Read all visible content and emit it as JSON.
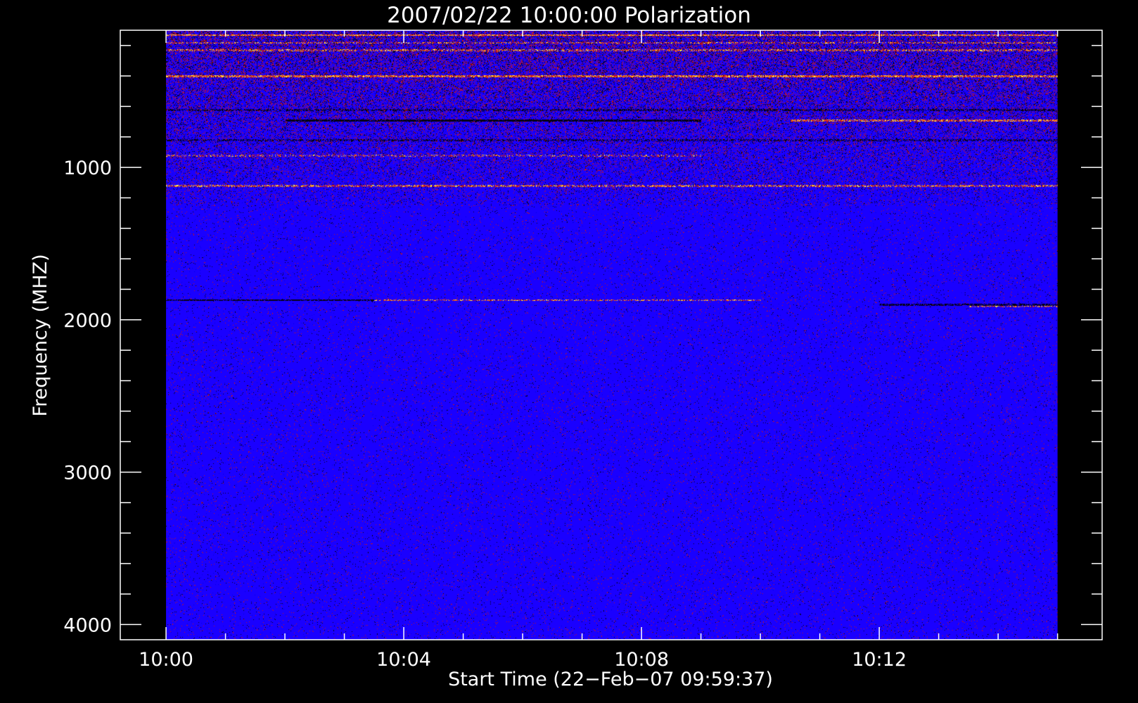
{
  "chart_data": {
    "type": "heatmap",
    "title": "2007/02/22 10:00:00 Polarization",
    "xlabel": "Start Time (22−Feb−07 09:59:37)",
    "ylabel": "Frequency (MHZ)",
    "x_ticks": [
      "10:00",
      "10:04",
      "10:08",
      "10:12"
    ],
    "x_tick_minutes": [
      0,
      4,
      8,
      12
    ],
    "x_range_minutes": [
      -0.77,
      15.75
    ],
    "x_data_range_minutes": [
      0,
      15
    ],
    "y_ticks": [
      1000,
      2000,
      3000,
      4000
    ],
    "y_range_mhz": [
      100,
      4100
    ],
    "y_data_range_mhz": [
      100,
      4100
    ],
    "y_inverted": true,
    "colors": {
      "background": "#000000",
      "axes": "#ffffff",
      "base_spectrum": "#1a00ff",
      "deep_blue": "#0000e6",
      "dark_line": "#050014",
      "red": "#c8141e",
      "orange": "#ff8c1e",
      "yellow": "#ffff50"
    },
    "features": [
      {
        "freq_mhz": 130,
        "kind": "bright",
        "start_min": 0,
        "end_min": 15,
        "intensity": 0.9
      },
      {
        "freq_mhz": 180,
        "kind": "bright",
        "start_min": 0,
        "end_min": 15,
        "intensity": 0.5
      },
      {
        "freq_mhz": 230,
        "kind": "bright",
        "start_min": 0,
        "end_min": 15,
        "intensity": 0.55
      },
      {
        "freq_mhz": 400,
        "kind": "bright",
        "start_min": 0,
        "end_min": 15,
        "intensity": 0.85
      },
      {
        "freq_mhz": 620,
        "kind": "dark",
        "start_min": 0,
        "end_min": 15,
        "intensity": 0.5
      },
      {
        "freq_mhz": 690,
        "kind": "dark",
        "start_min": 2,
        "end_min": 9,
        "intensity": 0.9
      },
      {
        "freq_mhz": 690,
        "kind": "bright",
        "start_min": 10.5,
        "end_min": 15,
        "intensity": 0.75
      },
      {
        "freq_mhz": 820,
        "kind": "dark",
        "start_min": 0,
        "end_min": 15,
        "intensity": 0.45
      },
      {
        "freq_mhz": 920,
        "kind": "bright",
        "start_min": 0,
        "end_min": 9,
        "intensity": 0.35
      },
      {
        "freq_mhz": 1120,
        "kind": "bright",
        "start_min": 0,
        "end_min": 15,
        "intensity": 0.6
      },
      {
        "freq_mhz": 1870,
        "kind": "dark",
        "start_min": 0,
        "end_min": 3.5,
        "intensity": 0.8
      },
      {
        "freq_mhz": 1870,
        "kind": "bright",
        "start_min": 3.5,
        "end_min": 10,
        "intensity": 0.6
      },
      {
        "freq_mhz": 1900,
        "kind": "dark",
        "start_min": 12,
        "end_min": 15,
        "intensity": 0.7
      },
      {
        "freq_mhz": 1910,
        "kind": "bright",
        "start_min": 13.5,
        "end_min": 15,
        "intensity": 0.55
      }
    ]
  }
}
